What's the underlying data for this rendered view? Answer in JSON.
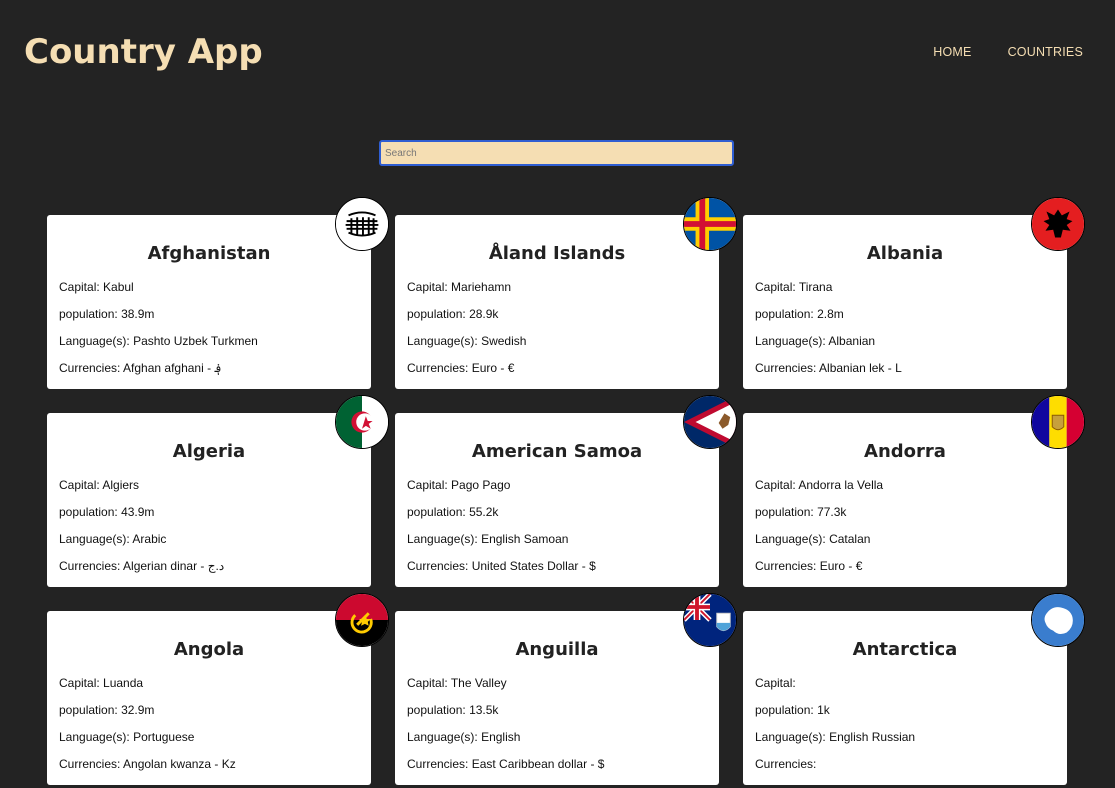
{
  "header": {
    "title": "Country App",
    "nav": [
      "HOME",
      "COUNTRIES"
    ]
  },
  "search": {
    "placeholder": "Search",
    "value": ""
  },
  "labels": {
    "capital": "Capital:",
    "population": "population:",
    "languages": "Language(s):",
    "currencies": "Currencies:"
  },
  "countries": [
    {
      "name": "Afghanistan",
      "capital": "Kabul",
      "population": "38.9m",
      "languages": "Pashto Uzbek Turkmen",
      "currencies": "Afghan afghani - ؋",
      "flag": "afghanistan-flag-icon"
    },
    {
      "name": "Åland Islands",
      "capital": "Mariehamn",
      "population": "28.9k",
      "languages": "Swedish",
      "currencies": "Euro - €",
      "flag": "aland-islands-flag-icon"
    },
    {
      "name": "Albania",
      "capital": "Tirana",
      "population": "2.8m",
      "languages": "Albanian",
      "currencies": "Albanian lek - L",
      "flag": "albania-flag-icon"
    },
    {
      "name": "Algeria",
      "capital": "Algiers",
      "population": "43.9m",
      "languages": "Arabic",
      "currencies": "Algerian dinar - د.ج",
      "flag": "algeria-flag-icon"
    },
    {
      "name": "American Samoa",
      "capital": "Pago Pago",
      "population": "55.2k",
      "languages": "English Samoan",
      "currencies": "United States Dollar - $",
      "flag": "american-samoa-flag-icon"
    },
    {
      "name": "Andorra",
      "capital": "Andorra la Vella",
      "population": "77.3k",
      "languages": "Catalan",
      "currencies": "Euro - €",
      "flag": "andorra-flag-icon"
    },
    {
      "name": "Angola",
      "capital": "Luanda",
      "population": "32.9m",
      "languages": "Portuguese",
      "currencies": "Angolan kwanza - Kz",
      "flag": "angola-flag-icon"
    },
    {
      "name": "Anguilla",
      "capital": "The Valley",
      "population": "13.5k",
      "languages": "English",
      "currencies": "East Caribbean dollar - $",
      "flag": "anguilla-flag-icon"
    },
    {
      "name": "Antarctica",
      "capital": "",
      "population": "1k",
      "languages": "English Russian",
      "currencies": "",
      "flag": "antarctica-flag-icon"
    }
  ]
}
